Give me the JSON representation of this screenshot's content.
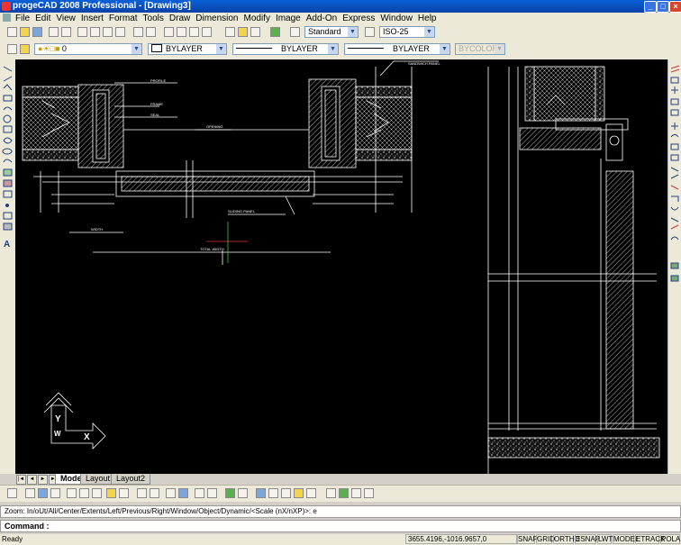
{
  "window": {
    "title": "progeCAD 2008 Professional - [Drawing3]",
    "minimize": "_",
    "maximize": "□",
    "close": "×"
  },
  "menu": [
    "File",
    "Edit",
    "View",
    "Insert",
    "Format",
    "Tools",
    "Draw",
    "Dimension",
    "Modify",
    "Image",
    "Add-On",
    "Express",
    "Window",
    "Help"
  ],
  "toolbar_standard": {
    "text_style": "Standard",
    "dim_style": "ISO-25"
  },
  "properties_bar": {
    "layer": "0",
    "color": "BYLAYER",
    "linetype": "BYLAYER",
    "lineweight": "BYLAYER",
    "plotstyle": "BYCOLOR"
  },
  "tabs": [
    "Model",
    "Layout1",
    "Layout2"
  ],
  "tab_nav": [
    "|◄",
    "◄",
    "►",
    "►|"
  ],
  "command_history": "Zoom:  In/oUt/All/Center/Extents/Left/Previous/Right/Window/Object/Dynamic/<Scale (nX/nXP)>: e",
  "command_prompt": "Command :",
  "status": {
    "ready": "Ready",
    "coordinates": "3655.4196,-1016.9657,0",
    "buttons": [
      "SNAP",
      "GRID",
      "ORTHO",
      "ESNAP",
      "LWT",
      "MODEL",
      "ETRACK",
      "POLAR"
    ]
  },
  "ucs": {
    "x": "X",
    "y": "Y",
    "w": "W"
  },
  "icons": [
    "new-icon",
    "open-icon",
    "save-icon",
    "print-icon",
    "cut-icon",
    "copy-icon",
    "paste-icon",
    "undo-icon",
    "redo-icon",
    "zoom-icon",
    "pan-icon",
    "layer-icon",
    "help-icon"
  ]
}
